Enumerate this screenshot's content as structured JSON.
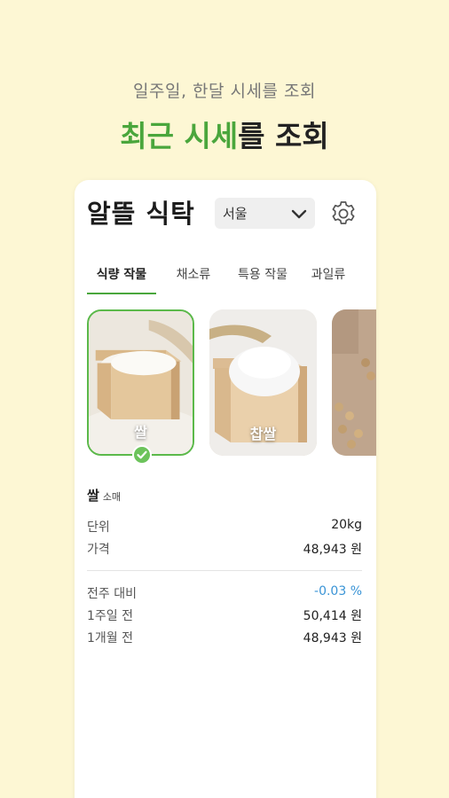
{
  "promo": {
    "subtitle": "일주일, 한달 시세를 조회",
    "title_accent": "최근 시세",
    "title_rest": "를 조회"
  },
  "app": {
    "title": "알뜰 식탁",
    "region": "서울",
    "settings_icon": "gear-icon",
    "dropdown_icon": "chevron-down-icon"
  },
  "tabs": [
    {
      "label": "식량 작물",
      "active": true
    },
    {
      "label": "채소류",
      "active": false
    },
    {
      "label": "특용 작물",
      "active": false
    },
    {
      "label": "과일류",
      "active": false
    }
  ],
  "cards": [
    {
      "label": "쌀",
      "selected": true
    },
    {
      "label": "찹쌀",
      "selected": false
    },
    {
      "label": "",
      "selected": false
    }
  ],
  "detail": {
    "name": "쌀",
    "grade": "소매",
    "unit_label": "단위",
    "unit_value": "20kg",
    "price_label": "가격",
    "price_value": "48,943 원",
    "wow_label": "전주 대비",
    "wow_value": "-0.03 %",
    "week_label": "1주일 전",
    "week_value": "50,414 원",
    "month_label": "1개월 전",
    "month_value": "48,943 원"
  },
  "colors": {
    "accent_green": "#4aa63c",
    "negative_blue": "#3a94d6",
    "background": "#fdf7d4"
  }
}
